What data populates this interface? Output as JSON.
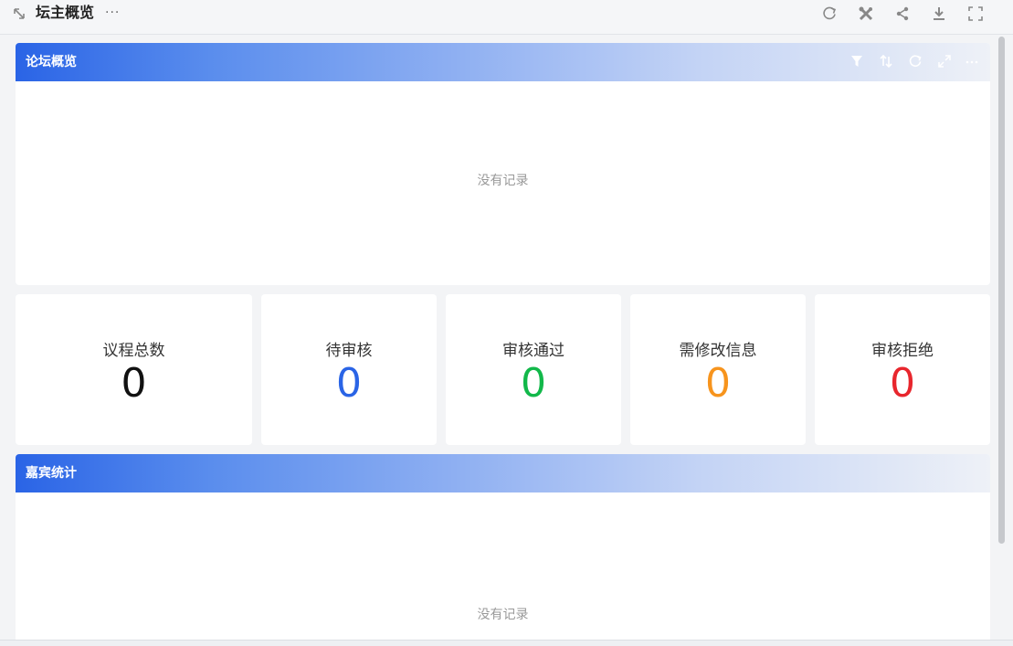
{
  "header": {
    "title": "坛主概览",
    "more": "···"
  },
  "forum_panel": {
    "title": "论坛概览",
    "empty_text": "没有记录"
  },
  "stats": [
    {
      "label": "议程总数",
      "value": "0",
      "color": "#111111"
    },
    {
      "label": "待审核",
      "value": "0",
      "color": "#2a64e6"
    },
    {
      "label": "审核通过",
      "value": "0",
      "color": "#12b84a"
    },
    {
      "label": "需修改信息",
      "value": "0",
      "color": "#f7941d"
    },
    {
      "label": "审核拒绝",
      "value": "0",
      "color": "#e8262d"
    }
  ],
  "guest_panel": {
    "title": "嘉宾统计",
    "empty_text": "没有记录"
  },
  "icons": {
    "topbar": [
      "refresh-icon",
      "tools-icon",
      "share-icon",
      "download-icon",
      "fullscreen-icon"
    ],
    "panel": [
      "filter-icon",
      "sort-icon",
      "refresh-icon",
      "expand-icon",
      "more-icon"
    ]
  }
}
